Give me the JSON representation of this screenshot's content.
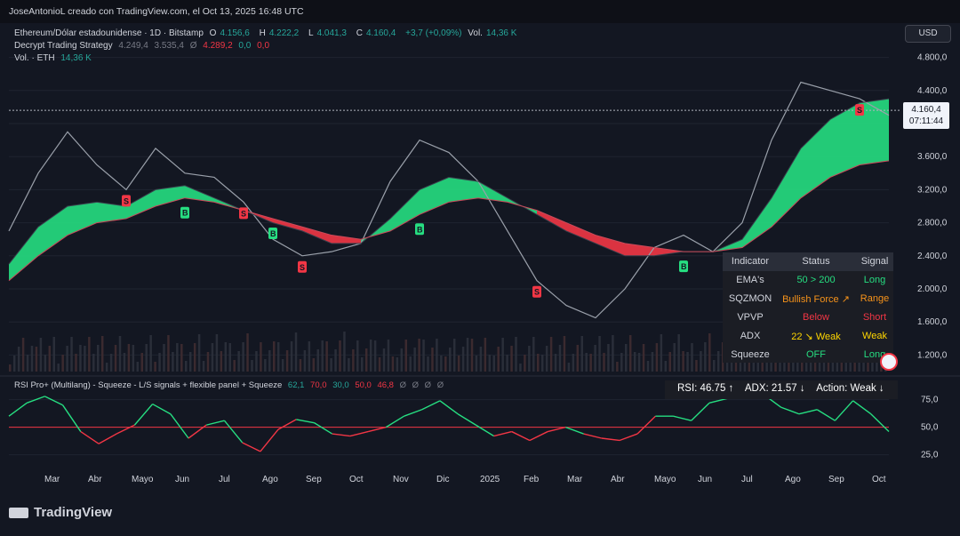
{
  "header": {
    "credit": "JoseAntonioL creado con TradingView.com, el Oct 13, 2025 16:48 UTC"
  },
  "legend": {
    "symbol": "Ethereum/Dólar estadounidense · 1D · Bitstamp",
    "o_label": "O",
    "o": "4.156,6",
    "h_label": "H",
    "h": "4.222,2",
    "l_label": "L",
    "l": "4.041,3",
    "c_label": "C",
    "c": "4.160,4",
    "change": "+3,7 (+0,09%)",
    "vol_label": "Vol.",
    "vol": "14,36 K",
    "strategy_name": "Decrypt Trading Strategy",
    "strategy_v1": "4.249,4",
    "strategy_v2": "3.535,4",
    "strategy_v3": "Ø",
    "strategy_v4": "4.289,2",
    "strategy_v5": "0,0",
    "strategy_v6": "0,0",
    "volume_name": "Vol. · ETH",
    "volume_value": "14,36 K"
  },
  "currency": "USD",
  "price_tag": {
    "price": "4.160,4",
    "countdown": "07:11:44"
  },
  "indicator_panel": {
    "headers": [
      "Indicator",
      "Status",
      "Signal"
    ],
    "rows": [
      {
        "indicator": "EMA's",
        "status": "50 > 200",
        "signal": "Long",
        "status_color": "#26de81",
        "signal_color": "#26de81"
      },
      {
        "indicator": "SQZMON",
        "status": "Bullish Force ↗",
        "signal": "Range",
        "status_color": "#f7931a",
        "signal_color": "#f7931a"
      },
      {
        "indicator": "VPVP",
        "status": "Below",
        "signal": "Short",
        "status_color": "#f23645",
        "signal_color": "#f23645"
      },
      {
        "indicator": "ADX",
        "status": "22 ↘ Weak",
        "signal": "Weak",
        "status_color": "#ffd600",
        "signal_color": "#ffd600"
      },
      {
        "indicator": "Squeeze",
        "status": "OFF",
        "signal": "Long",
        "status_color": "#26de81",
        "signal_color": "#26de81"
      }
    ]
  },
  "rsi_panel": {
    "label": "RSI Pro+ (Multilang) - Squeeze - L/S signals + flexible panel + Squeeze",
    "v1": "62,1",
    "v2": "70,0",
    "v3": "30,0",
    "v4": "50,0",
    "v5": "46,8",
    "v6": "Ø",
    "v7": "Ø",
    "v8": "Ø",
    "v9": "Ø",
    "status": {
      "rsi": "RSI: 46.75 ↑",
      "adx": "ADX: 21.57 ↓",
      "action": "Action: Weak ↓"
    }
  },
  "footer": {
    "brand": "TradingView"
  },
  "colors": {
    "bull": "#26de81",
    "bear": "#f23645",
    "rsi_line_up": "#26de81",
    "rsi_line_down": "#f23645",
    "background": "#131722"
  },
  "chart_data": {
    "type": "line",
    "title": "",
    "x_categories": [
      "Mar",
      "Abr",
      "Mayo",
      "Jun",
      "Jul",
      "Ago",
      "Sep",
      "Oct",
      "Nov",
      "Dic",
      "2025",
      "Feb",
      "Mar",
      "Abr",
      "Mayo",
      "Jun",
      "Jul",
      "Ago",
      "Sep",
      "Oct"
    ],
    "y_ticks": [
      1200,
      1600,
      2000,
      2400,
      2800,
      3200,
      3600,
      4000,
      4400,
      4800
    ],
    "y_tick_labels": [
      "1.200,0",
      "1.600,0",
      "2.000,0",
      "2.400,0",
      "2.800,0",
      "3.200,0",
      "3.600,0",
      "4.000,0",
      "4.400,0",
      "4.800,0"
    ],
    "ylim": [
      1000,
      5000
    ],
    "current_price": 4160.4,
    "series": [
      {
        "values": [
          2700,
          3400,
          3900,
          3500,
          3200,
          3700,
          3400,
          3350,
          3050,
          2600,
          2400,
          2450,
          2550,
          3300,
          3800,
          3650,
          3300,
          2700,
          2100,
          1800,
          1650,
          2000,
          2500,
          2650,
          2450,
          2800,
          3800,
          4500,
          4400,
          4300,
          4100
        ]
      },
      {
        "values": [
          2300,
          2750,
          3000,
          3050,
          3000,
          3200,
          3250,
          3100,
          2950,
          2800,
          2700,
          2550,
          2550,
          2850,
          3200,
          3350,
          3300,
          3100,
          2900,
          2700,
          2550,
          2400,
          2400,
          2450,
          2450,
          2600,
          3100,
          3700,
          4050,
          4250,
          4300
        ]
      },
      {
        "values": [
          2100,
          2400,
          2650,
          2800,
          2850,
          3000,
          3100,
          3050,
          2950,
          2850,
          2750,
          2650,
          2600,
          2700,
          2900,
          3050,
          3100,
          3050,
          2950,
          2800,
          2650,
          2550,
          2500,
          2450,
          2450,
          2500,
          2750,
          3100,
          3350,
          3500,
          3550
        ]
      }
    ],
    "signals": [
      {
        "type": "S",
        "x_index": 4
      },
      {
        "type": "B",
        "x_index": 6
      },
      {
        "type": "S",
        "x_index": 8
      },
      {
        "type": "B",
        "x_index": 9
      },
      {
        "type": "S",
        "x_index": 10
      },
      {
        "type": "B",
        "x_index": 14
      },
      {
        "type": "S",
        "x_index": 18
      },
      {
        "type": "B",
        "x_index": 23
      },
      {
        "type": "S",
        "x_index": 29
      }
    ],
    "rsi": {
      "y_ticks": [
        25,
        50,
        75
      ],
      "y_tick_labels": [
        "25,0",
        "50,0",
        "75,0"
      ],
      "ylim": [
        15,
        90
      ],
      "values": [
        60,
        72,
        78,
        70,
        46,
        35,
        44,
        52,
        71,
        62,
        40,
        52,
        56,
        36,
        28,
        48,
        57,
        54,
        44,
        42,
        46,
        50,
        60,
        66,
        74,
        62,
        52,
        42,
        46,
        38,
        46,
        50,
        44,
        40,
        38,
        44,
        60,
        60,
        56,
        72,
        76,
        84,
        80,
        68,
        62,
        66,
        56,
        74,
        62,
        46
      ]
    }
  }
}
